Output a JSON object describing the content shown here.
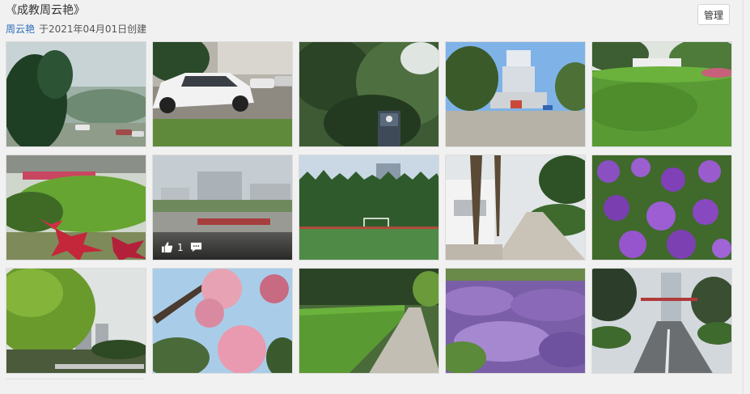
{
  "album": {
    "title": "《成教周云艳》",
    "author": "周云艳",
    "created": "于2021年04月01日创建"
  },
  "toolbar": {
    "manage_label": "管理"
  },
  "photo_overlay": {
    "like_count": "1"
  },
  "photo_count": 15
}
